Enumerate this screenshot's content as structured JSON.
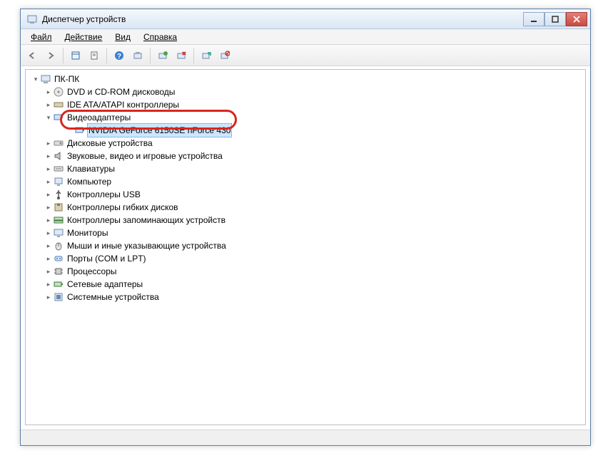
{
  "window": {
    "title": "Диспетчер устройств"
  },
  "menu": {
    "file": "Файл",
    "action": "Действие",
    "view": "Вид",
    "help": "Справка"
  },
  "tree": {
    "root": "ПК-ПК",
    "items": [
      {
        "label": "DVD и CD-ROM дисководы",
        "expandable": true
      },
      {
        "label": "IDE ATA/ATAPI контроллеры",
        "expandable": true
      },
      {
        "label": "Видеоадаптеры",
        "expandable": true,
        "expanded": true,
        "children": [
          {
            "label": "NVIDIA GeForce 6150SE nForce 430",
            "selected": true
          }
        ]
      },
      {
        "label": "Дисковые устройства",
        "expandable": true
      },
      {
        "label": "Звуковые, видео и игровые устройства",
        "expandable": true
      },
      {
        "label": "Клавиатуры",
        "expandable": true
      },
      {
        "label": "Компьютер",
        "expandable": true
      },
      {
        "label": "Контроллеры USB",
        "expandable": true
      },
      {
        "label": "Контроллеры гибких дисков",
        "expandable": true
      },
      {
        "label": "Контроллеры запоминающих устройств",
        "expandable": true
      },
      {
        "label": "Мониторы",
        "expandable": true
      },
      {
        "label": "Мыши и иные указывающие устройства",
        "expandable": true
      },
      {
        "label": "Порты (COM и LPT)",
        "expandable": true
      },
      {
        "label": "Процессоры",
        "expandable": true
      },
      {
        "label": "Сетевые адаптеры",
        "expandable": true
      },
      {
        "label": "Системные устройства",
        "expandable": true
      }
    ]
  }
}
